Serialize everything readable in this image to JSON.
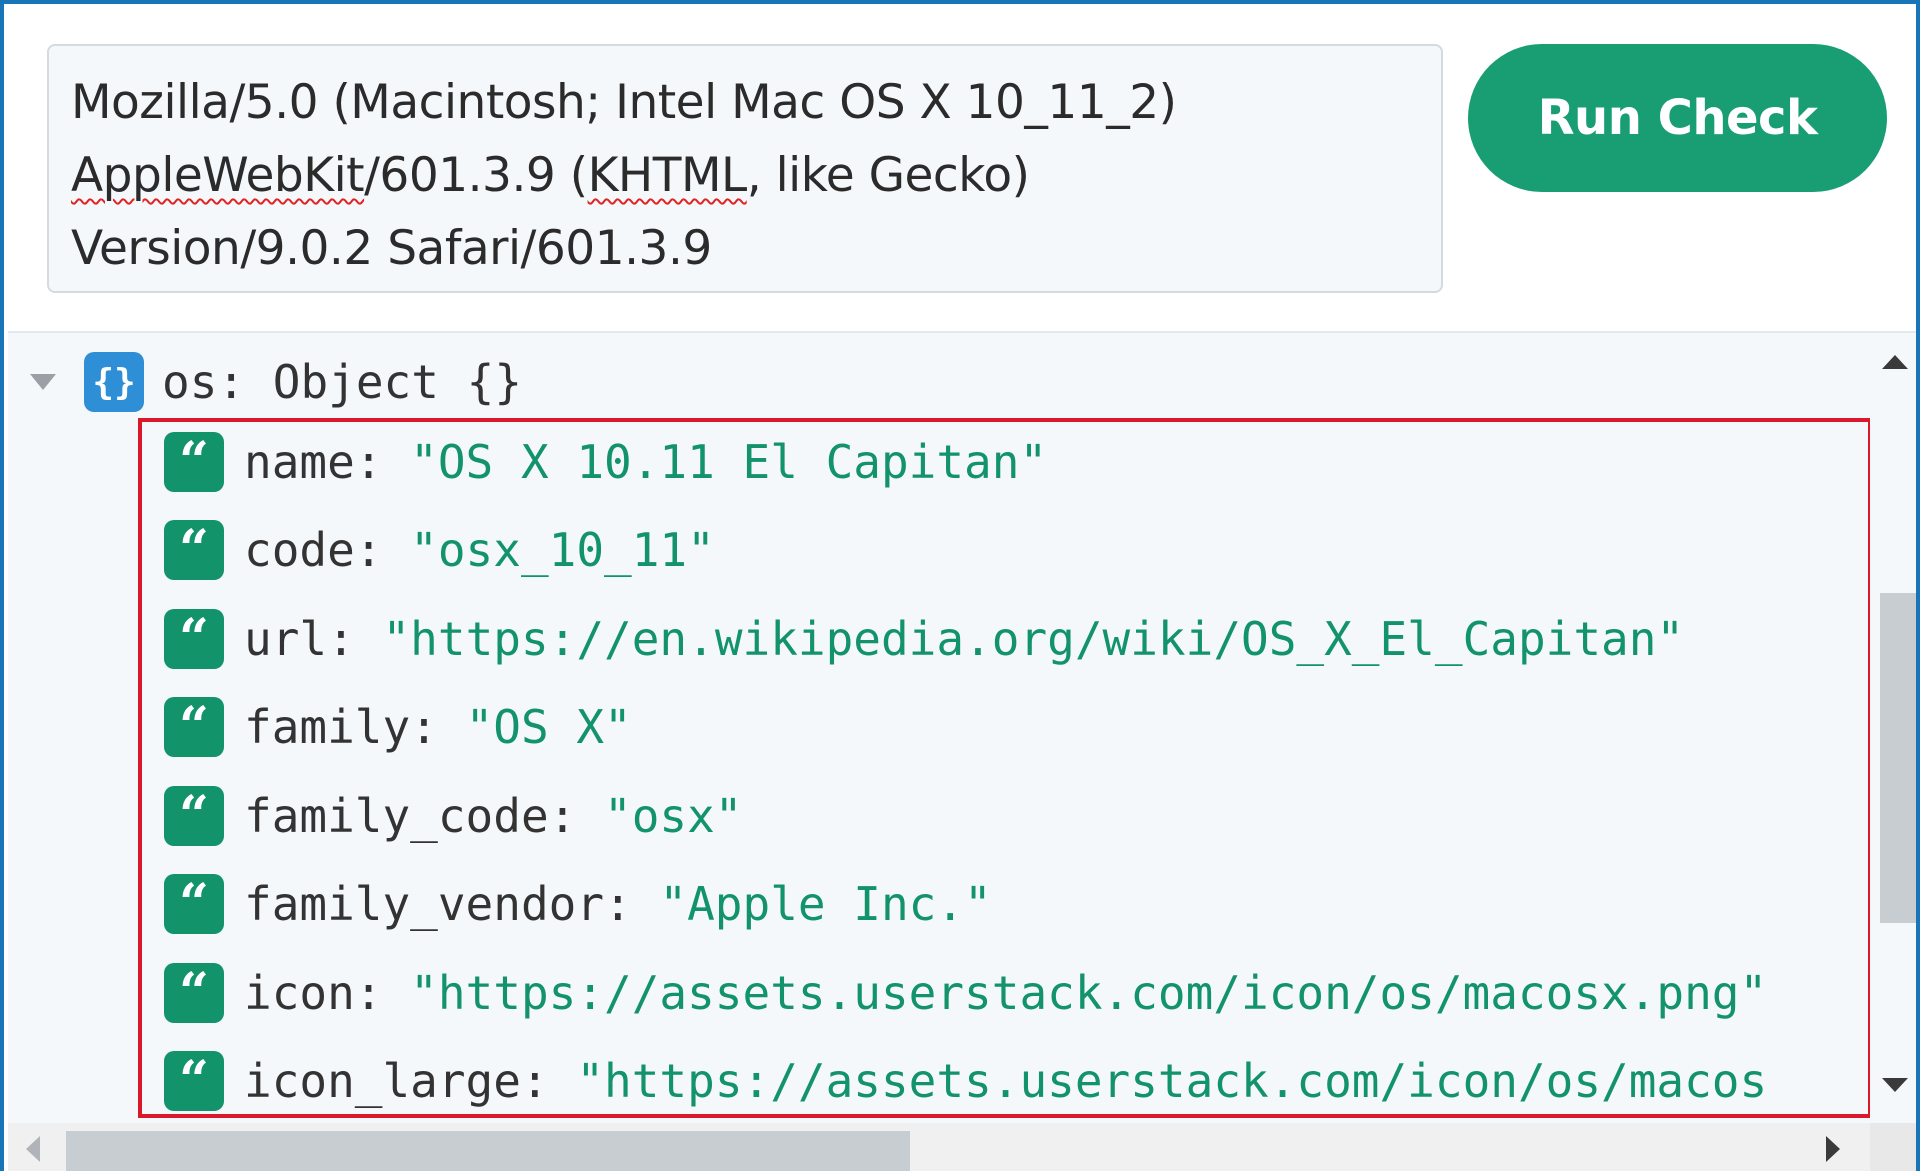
{
  "user_agent": {
    "line1": "Mozilla/5.0 (Macintosh; Intel Mac OS X 10_11_2)",
    "line2_part1": "AppleWebKit",
    "line2_part2": "/601.3.9 (",
    "line2_part3": "KHTML",
    "line2_part4": ", like Gecko)",
    "line3": "Version/9.0.2 Safari/601.3.9"
  },
  "run_button": {
    "label": "Run Check"
  },
  "tree": {
    "root_key": "os",
    "root_value": "Object {}",
    "properties": [
      {
        "key": "name",
        "value": "\"OS X 10.11 El Capitan\""
      },
      {
        "key": "code",
        "value": "\"osx_10_11\""
      },
      {
        "key": "url",
        "value": "\"https://en.wikipedia.org/wiki/OS_X_El_Capitan\""
      },
      {
        "key": "family",
        "value": "\"OS X\""
      },
      {
        "key": "family_code",
        "value": "\"osx\""
      },
      {
        "key": "family_vendor",
        "value": "\"Apple Inc.\""
      },
      {
        "key": "icon",
        "value": "\"https://assets.userstack.com/icon/os/macosx.png\""
      },
      {
        "key": "icon_large",
        "value": "\"https://assets.userstack.com/icon/os/macos"
      }
    ]
  },
  "icons": {
    "object": "object-braces-icon",
    "string": "string-quote-icon",
    "expand": "caret-down-icon"
  },
  "colors": {
    "frame_border": "#1a74b8",
    "button": "#199e74",
    "string_value": "#12936a",
    "object_icon": "#2e8fd6",
    "highlight": "#d9182b"
  }
}
